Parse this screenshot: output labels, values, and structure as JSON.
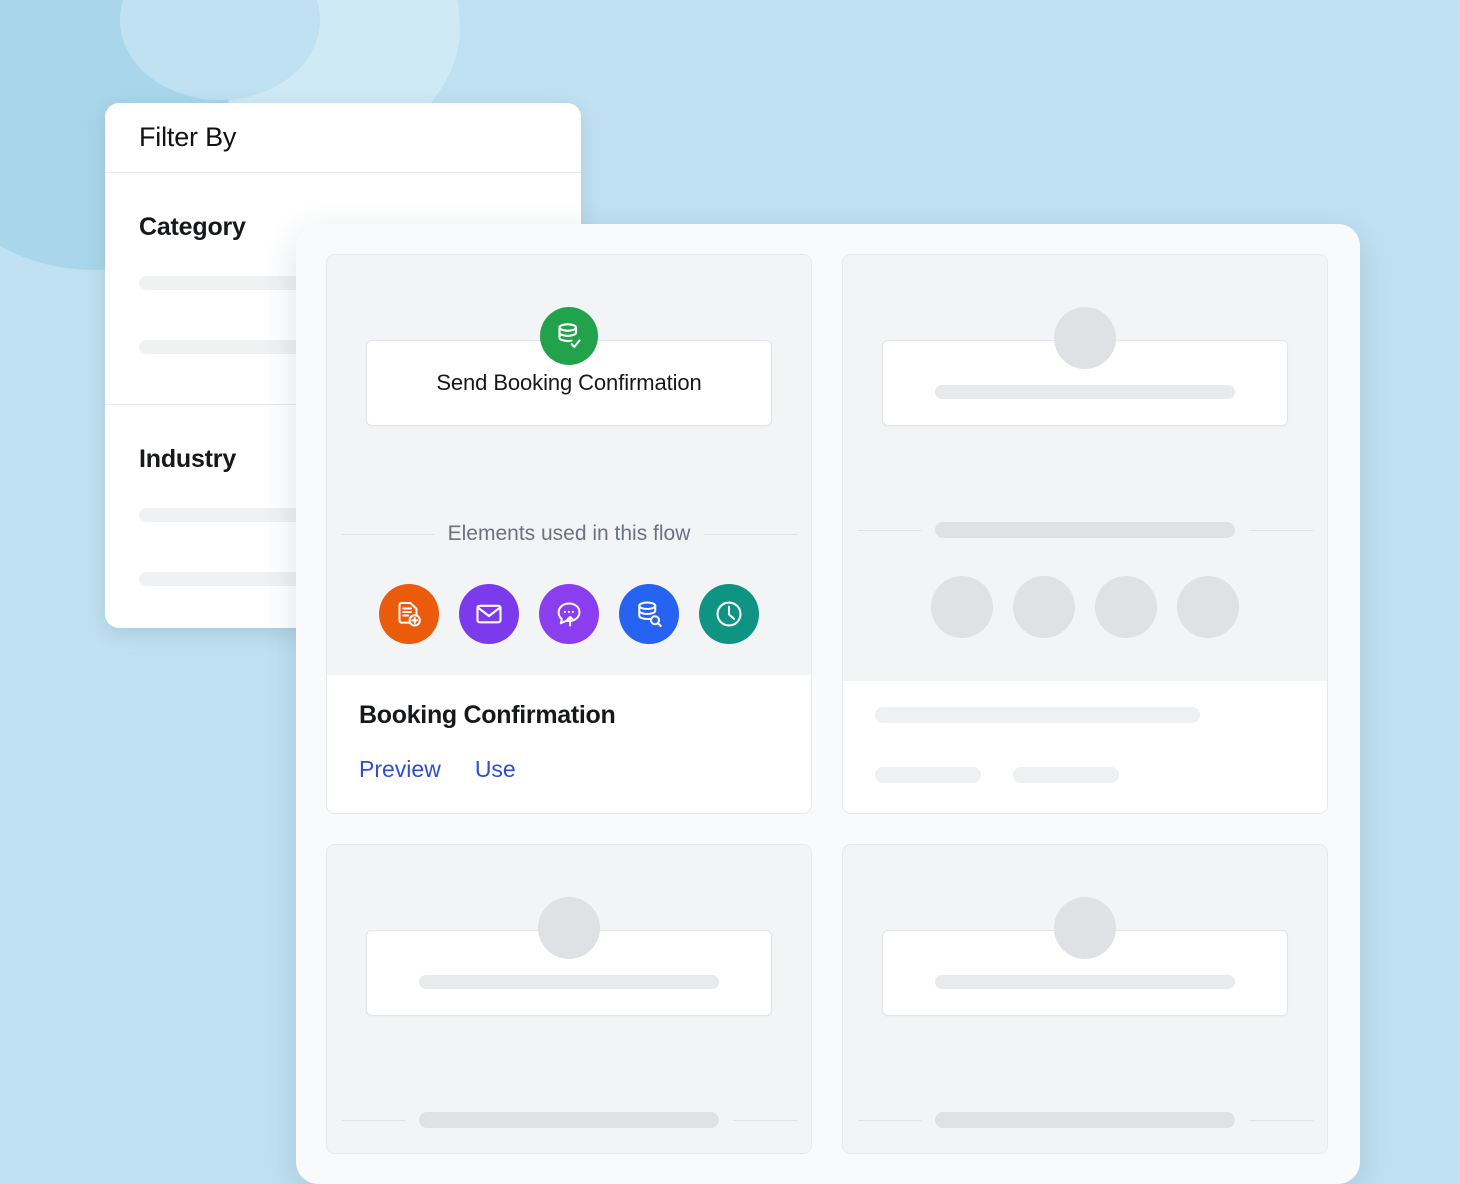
{
  "background": {
    "color": "#bfe1f1",
    "blob_color": "#a9d6eb"
  },
  "filter_panel": {
    "title": "Filter By",
    "sections": [
      {
        "heading": "Category",
        "placeholder_rows": 2
      },
      {
        "heading": "Industry",
        "placeholder_rows": 2
      }
    ]
  },
  "template_panel": {
    "featured_card": {
      "flow_node": {
        "label": "Send Booking Confirmation",
        "badge_icon": "database-check-icon",
        "badge_color": "#22a24a"
      },
      "elements_divider_label": "Elements used in this flow",
      "element_icons": [
        {
          "name": "document-add-icon",
          "color": "#ea5b0c"
        },
        {
          "name": "envelope-icon",
          "color": "#7c3aed"
        },
        {
          "name": "chat-send-icon",
          "color": "#8b3ef0"
        },
        {
          "name": "database-search-icon",
          "color": "#2563f0"
        },
        {
          "name": "clock-icon",
          "color": "#0f9383"
        }
      ],
      "title": "Booking Confirmation",
      "links": [
        {
          "label": "Preview",
          "color": "#2f4fce"
        },
        {
          "label": "Use",
          "color": "#2f4fce"
        }
      ]
    },
    "skeleton_cards": [
      {
        "id": "skeleton-card-top-right",
        "icon_count": 4,
        "footer_bars": 3
      },
      {
        "id": "skeleton-card-bottom-left",
        "icon_count": 0,
        "footer_bars": 0
      },
      {
        "id": "skeleton-card-bottom-right",
        "icon_count": 0,
        "footer_bars": 0
      }
    ]
  }
}
